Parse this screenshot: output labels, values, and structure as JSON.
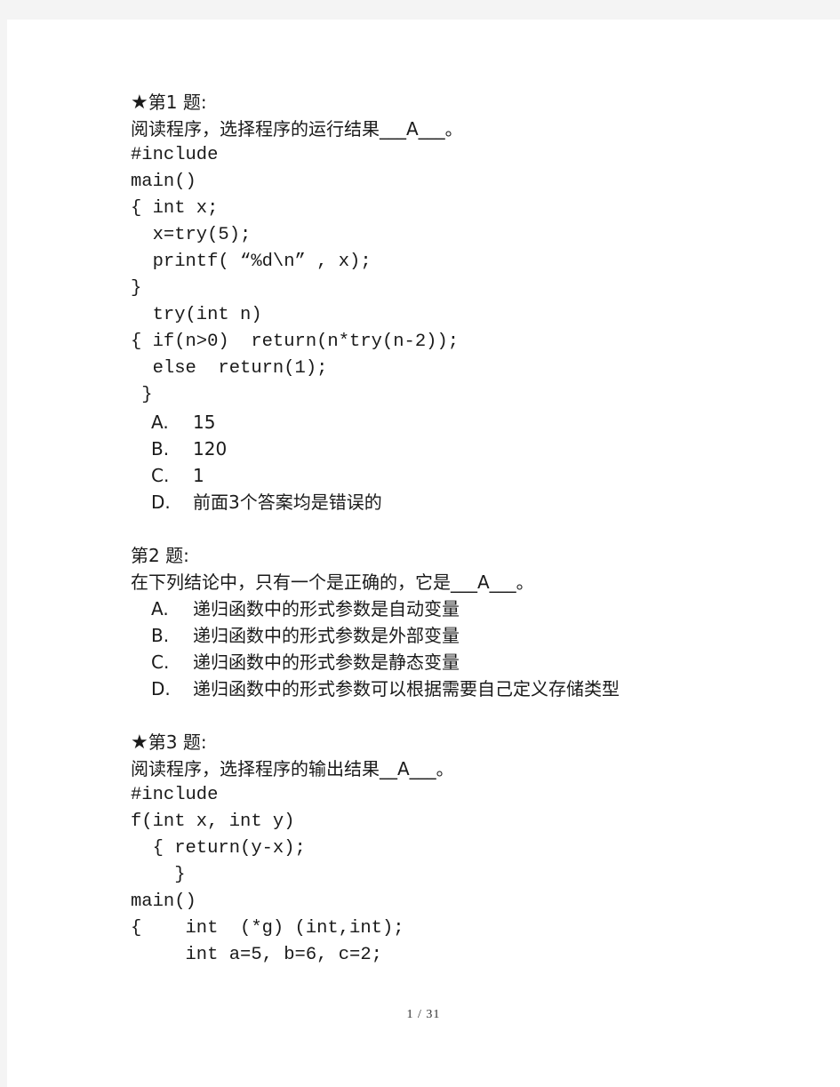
{
  "document": {
    "questions": [
      {
        "starred": true,
        "star_glyph": "★",
        "header": "第1 题:",
        "prompt": "阅读程序，选择程序的运行结果___A___。",
        "code": [
          "#include",
          "main()",
          "{ int x;",
          "  x=try(5);",
          "  printf( “%d\\n” , x);",
          "}",
          "  try(int n)",
          "{ if(n>0)  return(n*try(n-2));",
          "  else  return(1);",
          " }"
        ],
        "options": [
          {
            "letter": "A.",
            "text": "15"
          },
          {
            "letter": "B.",
            "text": "120"
          },
          {
            "letter": "C.",
            "text": "1"
          },
          {
            "letter": "D.",
            "text": "前面3个答案均是错误的"
          }
        ]
      },
      {
        "starred": false,
        "star_glyph": "",
        "header": "第2 题:",
        "prompt": "在下列结论中，只有一个是正确的，它是___A___。",
        "code": [],
        "options": [
          {
            "letter": "A.",
            "text": "递归函数中的形式参数是自动变量"
          },
          {
            "letter": "B.",
            "text": "递归函数中的形式参数是外部变量"
          },
          {
            "letter": "C.",
            "text": "递归函数中的形式参数是静态变量"
          },
          {
            "letter": "D.",
            "text": "递归函数中的形式参数可以根据需要自己定义存储类型"
          }
        ]
      },
      {
        "starred": true,
        "star_glyph": "★",
        "header": "第3 题:",
        "prompt": "阅读程序，选择程序的输出结果__A___。",
        "code": [
          "#include",
          "f(int x, int y)",
          "  { return(y-x);",
          "    }",
          "main()",
          "{    int  (*g) (int,int);",
          "     int a=5, b=6, c=2;"
        ],
        "options": []
      }
    ]
  },
  "footer": {
    "page_indicator": "1 / 31"
  }
}
